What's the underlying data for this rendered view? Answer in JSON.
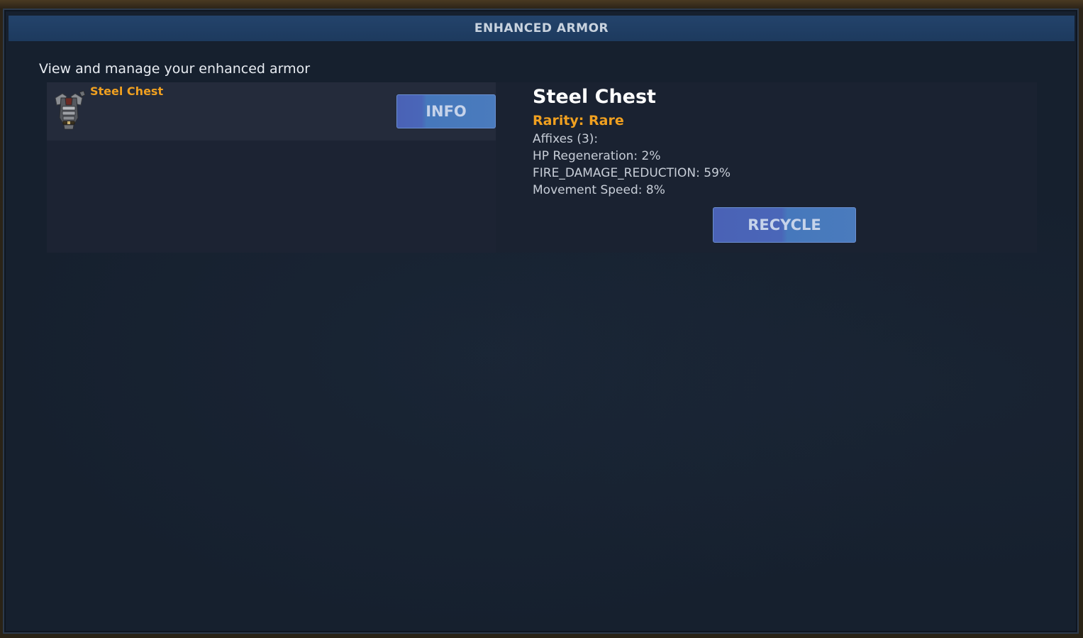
{
  "window": {
    "title": "ENHANCED ARMOR",
    "subtitle": "View and manage your enhanced armor"
  },
  "armor_list": {
    "items": [
      {
        "name": "Steel Chest",
        "icon": "steel-chest-armor-icon",
        "info_label": "INFO"
      }
    ]
  },
  "details": {
    "name": "Steel Chest",
    "rarity": "Rarity: Rare",
    "affix_header": "Affixes (3):",
    "affixes": [
      "HP Regeneration: 2%",
      "FIRE_DAMAGE_REDUCTION: 59%",
      "Movement Speed: 8%"
    ],
    "recycle_label": "RECYCLE"
  },
  "colors": {
    "rarity_rare": "#f0a020",
    "button_blue": "#4a6fb9",
    "window_bg": "#16202e",
    "title_bar": "#1f3d62"
  }
}
